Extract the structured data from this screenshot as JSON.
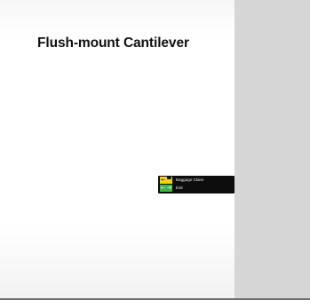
{
  "title": "Flush-mount Cantilever",
  "sign": {
    "rows": [
      {
        "label": "Baggage Claim",
        "symbol": "← ▀",
        "icon": "arrow-left-baggage-icon",
        "color": "#f2d21a"
      },
      {
        "label": "Exit",
        "symbol": "← ⇥",
        "icon": "arrow-left-exit-icon",
        "color": "#3fb44a"
      }
    ],
    "panel_color": "#0d0d0d"
  },
  "colors": {
    "wall": "#d6d6d6",
    "floor_rule": "#6e6e6e"
  }
}
